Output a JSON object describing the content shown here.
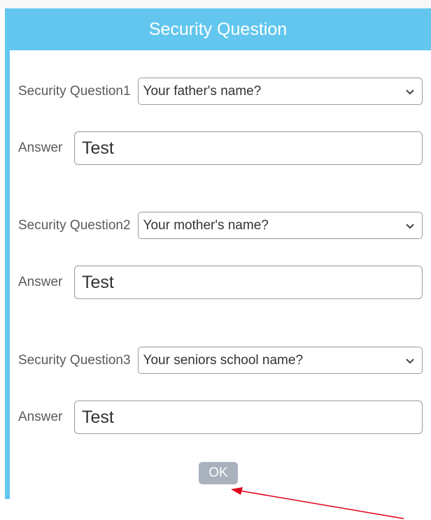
{
  "dialog": {
    "title": "Security Question",
    "questions": [
      {
        "label": "Security Question1",
        "selected": "Your father's name?",
        "answer_label": "Answer",
        "answer": "Test"
      },
      {
        "label": "Security Question2",
        "selected": "Your mother's name?",
        "answer_label": "Answer",
        "answer": "Test"
      },
      {
        "label": "Security Question3",
        "selected": "Your seniors school name?",
        "answer_label": "Answer",
        "answer": "Test"
      }
    ],
    "ok_label": "OK"
  },
  "colors": {
    "header": "#62c6ef",
    "ok_button": "#a9b1bd",
    "annotation_arrow": "#e0001b"
  },
  "icons": {
    "dropdown": "chevron-down-icon",
    "annotation": "red-arrow-icon"
  }
}
